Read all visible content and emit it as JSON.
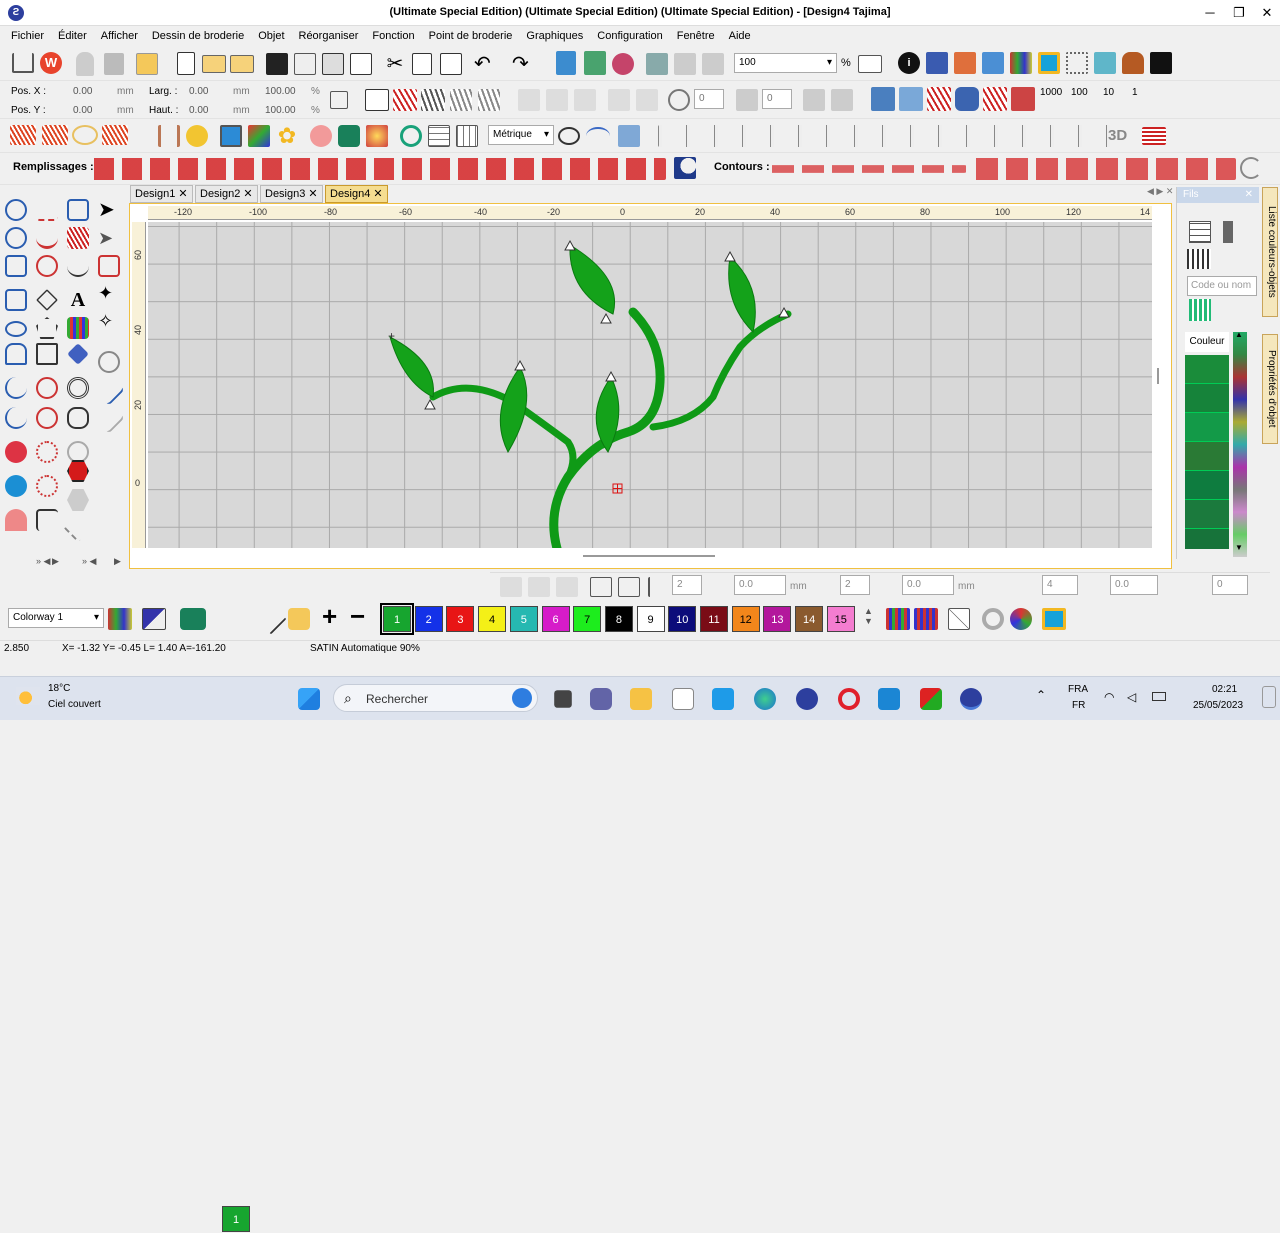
{
  "window": {
    "title": "(Ultimate Special Edition) (Ultimate Special Edition) (Ultimate Special Edition) - [Design4      Tajima]",
    "minimize": "─",
    "maximize": "❐",
    "close": "✕"
  },
  "menu": [
    "Fichier",
    "Éditer",
    "Afficher",
    "Dessin de broderie",
    "Objet",
    "Réorganiser",
    "Fonction",
    "Point de broderie",
    "Graphiques",
    "Configuration",
    "Fenêtre",
    "Aide"
  ],
  "toolbar": {
    "zoom_value": "100",
    "zoom_unit": "%",
    "units_select": "Métrique",
    "fills_label": "Remplissages :",
    "contours_label": "Contours :",
    "thickness_label": "3D"
  },
  "position": {
    "pos_x_label": "Pos. X :",
    "pos_x": "0.00",
    "pos_x_unit": "mm",
    "pos_y_label": "Pos. Y :",
    "pos_y": "0.00",
    "pos_y_unit": "mm",
    "width_label": "Larg. :",
    "width": "0.00",
    "width_unit": "mm",
    "width_pct": "100.00",
    "height_label": "Haut. :",
    "height": "0.00",
    "height_unit": "mm",
    "height_pct": "100.00",
    "pct_unit": "%"
  },
  "rotation": {
    "angle1": "0",
    "angle2": "0"
  },
  "tabs": [
    "Design1",
    "Design2",
    "Design3",
    "Design4"
  ],
  "active_tab": "Design4",
  "ruler": {
    "h_ticks": [
      "-120",
      "-100",
      "-80",
      "-60",
      "-40",
      "-20",
      "0",
      "20",
      "40",
      "60",
      "80",
      "100",
      "120",
      "14"
    ],
    "v_ticks": [
      "60",
      "40",
      "20",
      "0"
    ]
  },
  "panel": {
    "title": "Fils",
    "search_placeholder": "Code ou nom",
    "column": "Couleur",
    "tab_colors": "Liste couleurs-objets",
    "tab_props": "Propriétés d'objet",
    "thread_colors": [
      "#1a8c3a",
      "#16833a",
      "#139a48",
      "#2a7a35",
      "#0e7c3f",
      "#1b7a3d",
      "#17733a"
    ]
  },
  "colorway": {
    "label": "Colorway 1",
    "current": "1"
  },
  "swatches": [
    {
      "n": "1",
      "c": "#17a52f"
    },
    {
      "n": "2",
      "c": "#1431e8"
    },
    {
      "n": "3",
      "c": "#e81515"
    },
    {
      "n": "4",
      "c": "#f4f017"
    },
    {
      "n": "5",
      "c": "#26b8b1"
    },
    {
      "n": "6",
      "c": "#d61cc9"
    },
    {
      "n": "7",
      "c": "#1ded1d"
    },
    {
      "n": "8",
      "c": "#000000"
    },
    {
      "n": "9",
      "c": "#ffffff"
    },
    {
      "n": "10",
      "c": "#0c0c7a"
    },
    {
      "n": "11",
      "c": "#7a0c16"
    },
    {
      "n": "12",
      "c": "#f2861b"
    },
    {
      "n": "13",
      "c": "#b3179c"
    },
    {
      "n": "14",
      "c": "#8a5a2e"
    },
    {
      "n": "15",
      "c": "#f47dd0"
    }
  ],
  "bottom_tools": {
    "v1": "2",
    "v2": "0.0",
    "u1": "mm",
    "v3": "2",
    "v4": "0.0",
    "u2": "mm",
    "v5": "4",
    "v6": "0.0",
    "v7": "0"
  },
  "status": {
    "zoom": "2.850",
    "coords": "X=  -1.32 Y=   -0.45 L=      1.40 A=-161.20",
    "stitch": "SATIN Automatique 90%"
  },
  "taskbar": {
    "weather_temp": "18°C",
    "weather_desc": "Ciel couvert",
    "search": "Rechercher",
    "lang1": "FRA",
    "lang2": "FR",
    "time": "02:21",
    "date": "25/05/2023"
  }
}
